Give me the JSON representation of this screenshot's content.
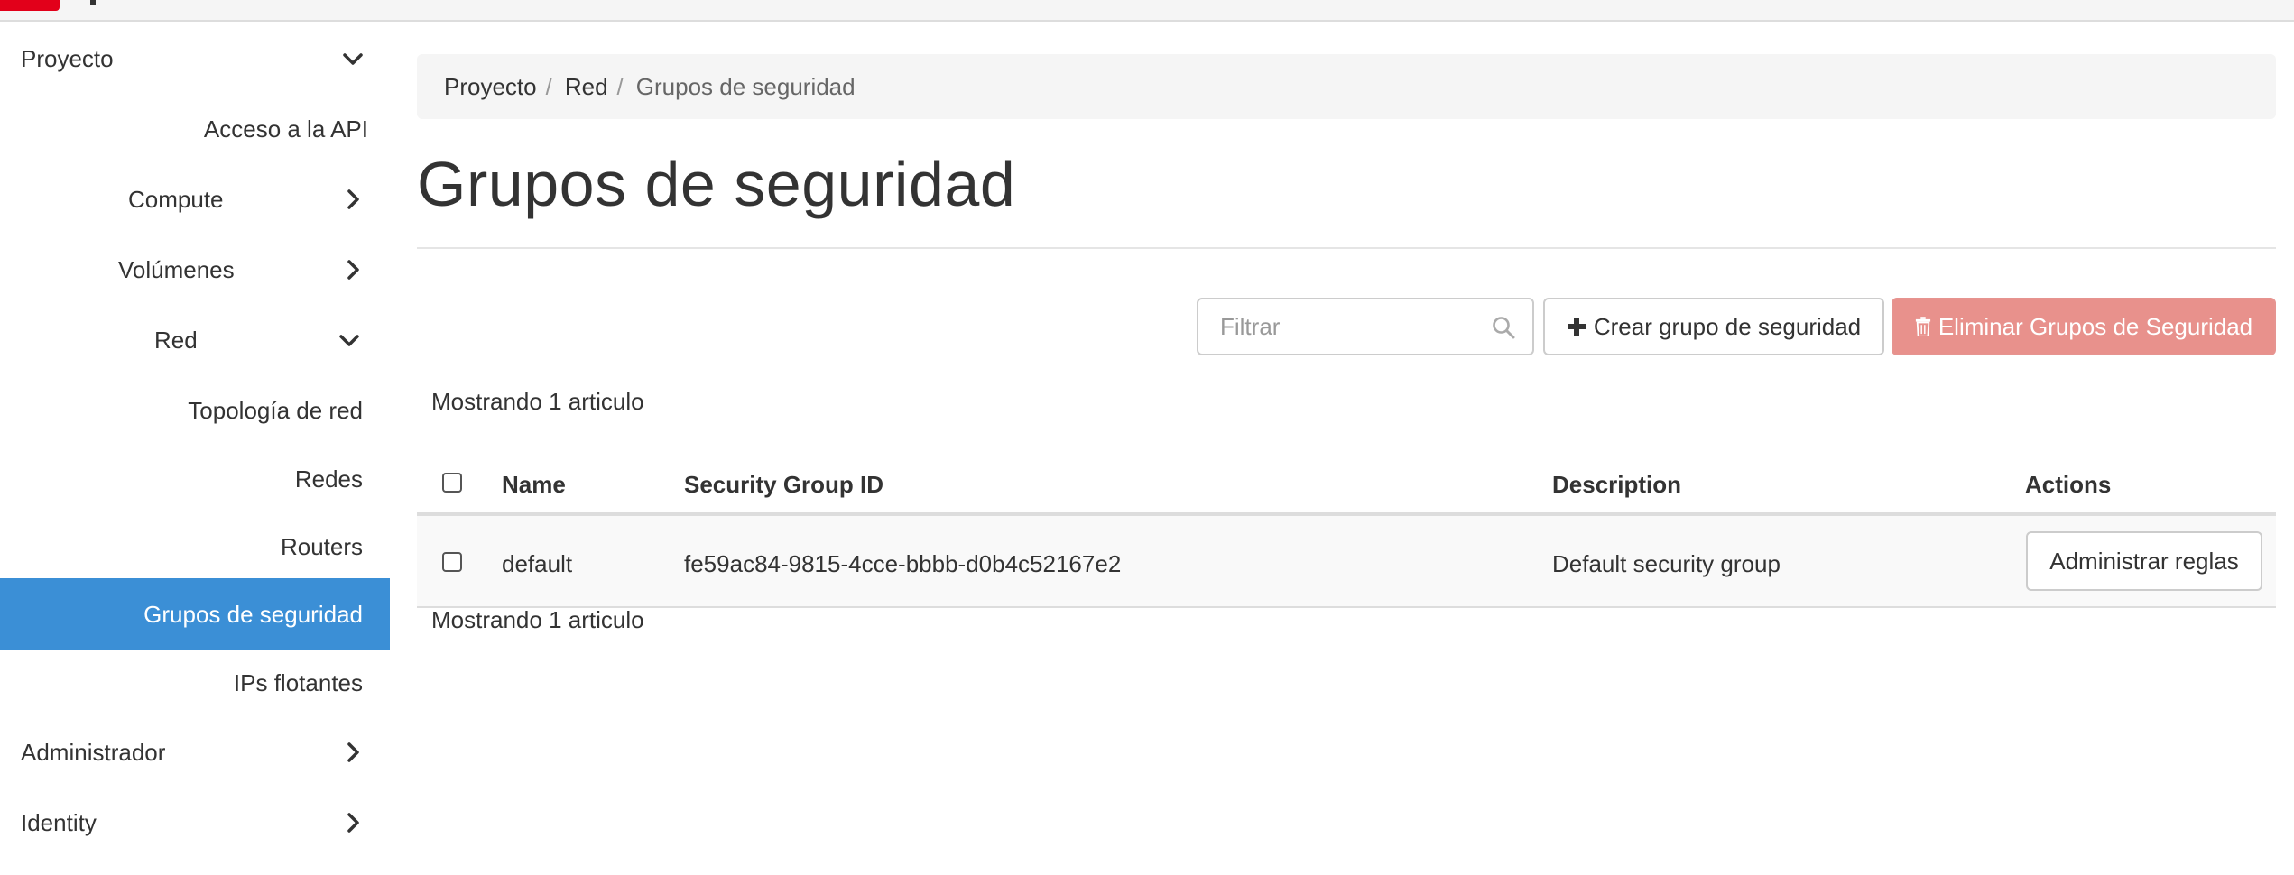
{
  "sidebar": {
    "items": [
      {
        "label": "Proyecto",
        "chevron": "down"
      },
      {
        "label": "Acceso a la API"
      },
      {
        "label": "Compute",
        "chevron": "right"
      },
      {
        "label": "Volúmenes",
        "chevron": "right"
      },
      {
        "label": "Red",
        "chevron": "down"
      },
      {
        "label": "Topología de red"
      },
      {
        "label": "Redes"
      },
      {
        "label": "Routers"
      },
      {
        "label": "Grupos de seguridad",
        "active": true
      },
      {
        "label": "IPs flotantes"
      },
      {
        "label": "Administrador",
        "chevron": "right"
      },
      {
        "label": "Identity",
        "chevron": "right"
      }
    ]
  },
  "breadcrumb": {
    "items": [
      "Proyecto",
      "Red",
      "Grupos de seguridad"
    ],
    "separator": "/"
  },
  "page": {
    "title": "Grupos de seguridad"
  },
  "toolbar": {
    "filter_placeholder": "Filtrar",
    "create_label": "Crear grupo de seguridad",
    "delete_label": "Eliminar Grupos de Seguridad"
  },
  "table": {
    "count_top": "Mostrando 1 articulo",
    "count_bottom": "Mostrando 1 articulo",
    "columns": [
      "Name",
      "Security Group ID",
      "Description",
      "Actions"
    ],
    "rows": [
      {
        "name": "default",
        "id": "fe59ac84-9815-4cce-bbbb-d0b4c52167e2",
        "description": "Default security group",
        "action": "Administrar reglas"
      }
    ]
  },
  "colors": {
    "active_nav": "#3b8fd6",
    "danger_button": "#e8918c",
    "brand": "#e2001a"
  },
  "icons": {
    "chevron_down": "chevron-down-icon",
    "chevron_right": "chevron-right-icon",
    "search": "search-icon",
    "plus": "plus-icon",
    "trash": "trash-icon"
  }
}
